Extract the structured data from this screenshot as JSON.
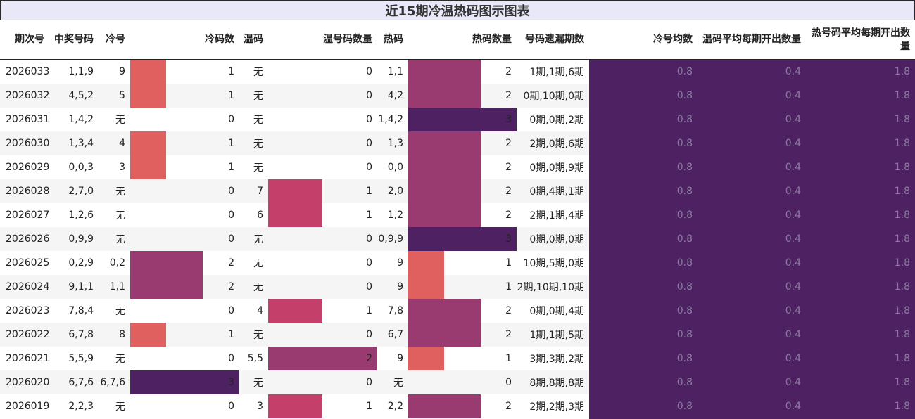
{
  "title": "近15期冷温热码图示图表",
  "headers": {
    "period": "期次号",
    "winning": "中奖号码",
    "cold": "冷号",
    "cold_count": "冷码数",
    "warm": "温码",
    "warm_count": "温号码数量",
    "hot": "热码",
    "hot_count": "热码数量",
    "missing": "号码遗漏期数",
    "cold_avg": "冷号均数",
    "warm_avg": "温码平均每期开出数量",
    "hot_avg": "热号码平均每期开出数量"
  },
  "colors": {
    "level1": "#e06060",
    "level2": "#993a70",
    "level3": "#4e2262",
    "warm1": "#c4406a",
    "avg_bg": "#4e2262"
  },
  "rows": [
    {
      "period": "2026033",
      "winning": "1,1,9",
      "cold": "9",
      "cold_count": "1",
      "warm": "无",
      "warm_count": "0",
      "hot": "1,1",
      "hot_count": "2",
      "missing": "1期,1期,6期",
      "cold_avg": "0.8",
      "warm_avg": "0.4",
      "hot_avg": "1.8"
    },
    {
      "period": "2026032",
      "winning": "4,5,2",
      "cold": "5",
      "cold_count": "1",
      "warm": "无",
      "warm_count": "0",
      "hot": "4,2",
      "hot_count": "2",
      "missing": "0期,10期,0期",
      "cold_avg": "0.8",
      "warm_avg": "0.4",
      "hot_avg": "1.8"
    },
    {
      "period": "2026031",
      "winning": "1,4,2",
      "cold": "无",
      "cold_count": "0",
      "warm": "无",
      "warm_count": "0",
      "hot": "1,4,2",
      "hot_count": "3",
      "missing": "0期,0期,2期",
      "cold_avg": "0.8",
      "warm_avg": "0.4",
      "hot_avg": "1.8"
    },
    {
      "period": "2026030",
      "winning": "1,3,4",
      "cold": "4",
      "cold_count": "1",
      "warm": "无",
      "warm_count": "0",
      "hot": "1,3",
      "hot_count": "2",
      "missing": "2期,0期,6期",
      "cold_avg": "0.8",
      "warm_avg": "0.4",
      "hot_avg": "1.8"
    },
    {
      "period": "2026029",
      "winning": "0,0,3",
      "cold": "3",
      "cold_count": "1",
      "warm": "无",
      "warm_count": "0",
      "hot": "0,0",
      "hot_count": "2",
      "missing": "0期,0期,9期",
      "cold_avg": "0.8",
      "warm_avg": "0.4",
      "hot_avg": "1.8"
    },
    {
      "period": "2026028",
      "winning": "2,7,0",
      "cold": "无",
      "cold_count": "0",
      "warm": "7",
      "warm_count": "1",
      "hot": "2,0",
      "hot_count": "2",
      "missing": "0期,4期,1期",
      "cold_avg": "0.8",
      "warm_avg": "0.4",
      "hot_avg": "1.8"
    },
    {
      "period": "2026027",
      "winning": "1,2,6",
      "cold": "无",
      "cold_count": "0",
      "warm": "6",
      "warm_count": "1",
      "hot": "1,2",
      "hot_count": "2",
      "missing": "2期,1期,4期",
      "cold_avg": "0.8",
      "warm_avg": "0.4",
      "hot_avg": "1.8"
    },
    {
      "period": "2026026",
      "winning": "0,9,9",
      "cold": "无",
      "cold_count": "0",
      "warm": "无",
      "warm_count": "0",
      "hot": "0,9,9",
      "hot_count": "3",
      "missing": "0期,0期,0期",
      "cold_avg": "0.8",
      "warm_avg": "0.4",
      "hot_avg": "1.8"
    },
    {
      "period": "2026025",
      "winning": "0,2,9",
      "cold": "0,2",
      "cold_count": "2",
      "warm": "无",
      "warm_count": "0",
      "hot": "9",
      "hot_count": "1",
      "missing": "10期,5期,0期",
      "cold_avg": "0.8",
      "warm_avg": "0.4",
      "hot_avg": "1.8"
    },
    {
      "period": "2026024",
      "winning": "9,1,1",
      "cold": "1,1",
      "cold_count": "2",
      "warm": "无",
      "warm_count": "0",
      "hot": "9",
      "hot_count": "1",
      "missing": "2期,10期,10期",
      "cold_avg": "0.8",
      "warm_avg": "0.4",
      "hot_avg": "1.8"
    },
    {
      "period": "2026023",
      "winning": "7,8,4",
      "cold": "无",
      "cold_count": "0",
      "warm": "4",
      "warm_count": "1",
      "hot": "7,8",
      "hot_count": "2",
      "missing": "0期,0期,4期",
      "cold_avg": "0.8",
      "warm_avg": "0.4",
      "hot_avg": "1.8"
    },
    {
      "period": "2026022",
      "winning": "6,7,8",
      "cold": "8",
      "cold_count": "1",
      "warm": "无",
      "warm_count": "0",
      "hot": "6,7",
      "hot_count": "2",
      "missing": "1期,1期,5期",
      "cold_avg": "0.8",
      "warm_avg": "0.4",
      "hot_avg": "1.8"
    },
    {
      "period": "2026021",
      "winning": "5,5,9",
      "cold": "无",
      "cold_count": "0",
      "warm": "5,5",
      "warm_count": "2",
      "hot": "9",
      "hot_count": "1",
      "missing": "3期,3期,2期",
      "cold_avg": "0.8",
      "warm_avg": "0.4",
      "hot_avg": "1.8"
    },
    {
      "period": "2026020",
      "winning": "6,7,6",
      "cold": "6,7,6",
      "cold_count": "3",
      "warm": "无",
      "warm_count": "0",
      "hot": "无",
      "hot_count": "0",
      "missing": "8期,8期,8期",
      "cold_avg": "0.8",
      "warm_avg": "0.4",
      "hot_avg": "1.8"
    },
    {
      "period": "2026019",
      "winning": "2,2,3",
      "cold": "无",
      "cold_count": "0",
      "warm": "3",
      "warm_count": "1",
      "hot": "2,2",
      "hot_count": "2",
      "missing": "2期,2期,3期",
      "cold_avg": "0.8",
      "warm_avg": "0.4",
      "hot_avg": "1.8"
    }
  ]
}
